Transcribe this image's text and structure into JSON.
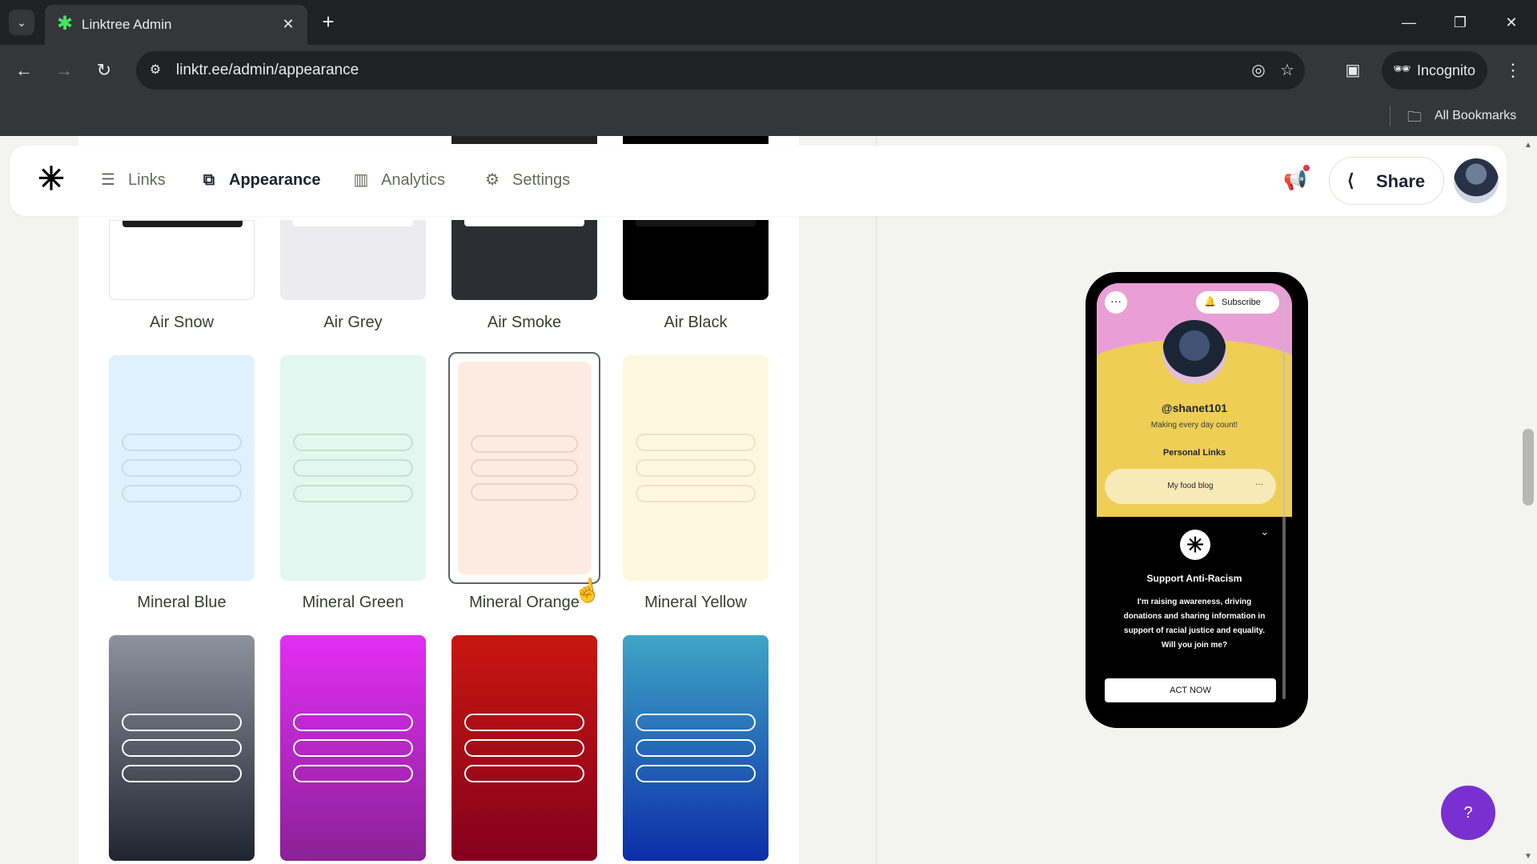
{
  "browser": {
    "tab_title": "Linktree Admin",
    "url": "linktr.ee/admin/appearance",
    "incognito_label": "Incognito",
    "bookmarks_label": "All Bookmarks"
  },
  "app_nav": {
    "items": [
      {
        "label": "Links",
        "icon": "links-icon"
      },
      {
        "label": "Appearance",
        "icon": "appearance-icon",
        "active": true
      },
      {
        "label": "Analytics",
        "icon": "analytics-icon"
      },
      {
        "label": "Settings",
        "icon": "settings-icon"
      }
    ],
    "share_label": "Share"
  },
  "themes": {
    "row1": [
      "Air Snow",
      "Air Grey",
      "Air Smoke",
      "Air Black"
    ],
    "row2": [
      "Mineral Blue",
      "Mineral Green",
      "Mineral Orange",
      "Mineral Yellow"
    ],
    "selected": "Mineral Orange",
    "colors": {
      "air_snow": "#ffffff",
      "air_grey": "#ececee",
      "air_smoke": "#2b2e33",
      "air_black": "#000000",
      "mineral_blue": "#e0f1fd",
      "mineral_green": "#e1f7ef",
      "mineral_orange": "#fdebe1",
      "mineral_yellow": "#fef7e0"
    }
  },
  "preview": {
    "subscribe_label": "Subscribe",
    "handle": "@shanet101",
    "bio": "Making every day count!",
    "section_title": "Personal Links",
    "link_label": "My food blog",
    "banner_title": "Support Anti-Racism",
    "banner_body": "I'm raising awareness, driving donations and sharing information in support of racial justice and equality. Will you join me?",
    "cta_label": "ACT NOW"
  },
  "help_label": "?"
}
